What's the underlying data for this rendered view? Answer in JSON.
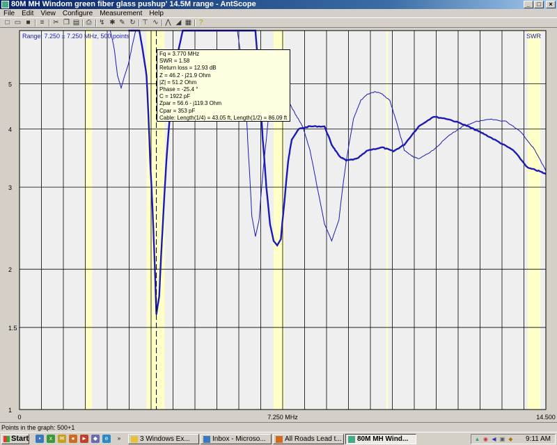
{
  "window": {
    "title": "80M MH Windom green fiber glass pushup' 14.5M range - AntScope",
    "minimize_glyph": "_",
    "maximize_glyph": "□",
    "close_glyph": "×"
  },
  "menu": [
    "File",
    "Edit",
    "View",
    "Configure",
    "Measurement",
    "Help"
  ],
  "toolbar_icons": [
    "new-icon",
    "open-icon",
    "save-icon",
    "properties-icon",
    "cut-icon",
    "copy-icon",
    "paste-icon",
    "print-icon",
    "scan-icon",
    "stop-icon",
    "edit-icon",
    "refresh-icon",
    "marker-icon",
    "freeze-icon",
    "filter-icon",
    "chart-icon",
    "table-icon",
    "help-icon"
  ],
  "chart_data": {
    "type": "line",
    "range_label": "Range: 7.250 ± 7.250 MHz, 500 points",
    "series_label": "SWR",
    "x_tick_labels": [
      "0",
      "7.250 MHz",
      "14.500"
    ],
    "y_tick_labels": [
      "1",
      "1.5",
      "2",
      "3",
      "4",
      "5"
    ],
    "x_range_mhz": [
      0,
      14.5
    ],
    "y_scale": "log",
    "y_range": [
      1,
      6.5
    ],
    "grid": true,
    "cursor_x_mhz": 3.77,
    "band_highlights_mhz": [
      [
        1.8,
        2.0
      ],
      [
        3.5,
        4.0
      ],
      [
        7.0,
        7.3
      ],
      [
        10.1,
        10.15
      ],
      [
        14.0,
        14.35
      ]
    ],
    "series": [
      {
        "style": "thick",
        "x": [
          3.0,
          3.3,
          3.5,
          3.6,
          3.7,
          3.77,
          3.85,
          3.95,
          4.1,
          4.3,
          4.5,
          4.7,
          4.9,
          5.0,
          5.1,
          5.2,
          6.5,
          6.6,
          6.7,
          6.8,
          6.9,
          7.0,
          7.1,
          7.2,
          7.3,
          7.4,
          7.5,
          7.7,
          8.0,
          8.4,
          8.6,
          8.8,
          9.0,
          9.3,
          9.6,
          10.0,
          10.3,
          10.6,
          11.0,
          11.4,
          11.8,
          12.2,
          12.5,
          12.8,
          13.2,
          13.6,
          14.0,
          14.3,
          14.5
        ],
        "y": [
          6.5,
          6.5,
          5.2,
          3.4,
          2.3,
          1.6,
          1.75,
          2.5,
          3.9,
          5.5,
          6.5,
          6.5,
          6.5,
          6.5,
          6.5,
          6.5,
          6.5,
          5.0,
          3.8,
          3.0,
          2.5,
          2.3,
          2.25,
          2.32,
          2.8,
          3.4,
          3.8,
          4.0,
          4.05,
          4.05,
          3.7,
          3.5,
          3.42,
          3.45,
          3.6,
          3.65,
          3.58,
          3.7,
          4.05,
          4.25,
          4.2,
          4.1,
          4.0,
          3.9,
          3.75,
          3.6,
          3.3,
          3.25,
          3.2
        ]
      },
      {
        "style": "thin",
        "x": [
          2.5,
          2.6,
          2.7,
          2.8,
          3.0,
          3.2,
          3.5,
          4.0,
          4.5,
          5.0,
          5.5,
          6.0,
          6.2,
          6.3,
          6.4,
          6.5,
          6.6,
          6.8,
          7.0,
          7.2,
          7.4,
          7.6,
          7.8,
          8.0,
          8.2,
          8.4,
          8.6,
          8.8,
          9.0,
          9.2,
          9.4,
          9.6,
          9.8,
          10.0,
          10.2,
          10.4,
          10.6,
          10.8,
          11.0,
          11.4,
          11.8,
          12.2,
          12.6,
          13.0,
          13.4,
          13.8,
          14.2,
          14.5
        ],
        "y": [
          6.5,
          6.0,
          5.2,
          4.9,
          5.5,
          6.5,
          6.5,
          6.5,
          6.5,
          6.5,
          6.5,
          6.5,
          5.0,
          3.6,
          2.6,
          2.35,
          2.55,
          3.8,
          5.3,
          5.0,
          4.6,
          4.3,
          4.05,
          3.6,
          3.0,
          2.5,
          2.3,
          2.55,
          3.4,
          4.2,
          4.6,
          4.75,
          4.8,
          4.75,
          4.6,
          4.1,
          3.6,
          3.5,
          3.45,
          3.6,
          3.85,
          4.05,
          4.15,
          4.2,
          4.15,
          3.95,
          3.6,
          3.25
        ]
      }
    ]
  },
  "tooltip": {
    "lines": [
      "Fq = 3.770 MHz",
      "SWR = 1.58",
      "Return loss = 12.93 dB",
      "Z = 46.2 - j21.9 Ohm",
      "|Z| = 51.2 Ohm",
      "Phase = -25.4 °",
      "C = 1922 pF",
      "Zpar = 56.6 - j119.3 Ohm",
      "Cpar = 353 pF",
      "Cable: Length(1/4) = 43.05 ft, Length(1/2) = 86.09 ft"
    ]
  },
  "status": {
    "text": "Points in the graph: 500+1"
  },
  "taskbar": {
    "start_label": "Start",
    "tasks": [
      {
        "label": "3 Windows Ex...",
        "active": false
      },
      {
        "label": "Inbox - Microso...",
        "active": false
      },
      {
        "label": "All Roads Lead t...",
        "active": false
      },
      {
        "label": "80M MH Wind...",
        "active": true
      }
    ],
    "clock": "9:11 AM"
  },
  "colors": {
    "trace": "#1a1ab4",
    "plot_bg": "#efefef",
    "band_highlight": "#ffffc8",
    "grid": "#000000",
    "tooltip_bg": "#ffffe1"
  }
}
